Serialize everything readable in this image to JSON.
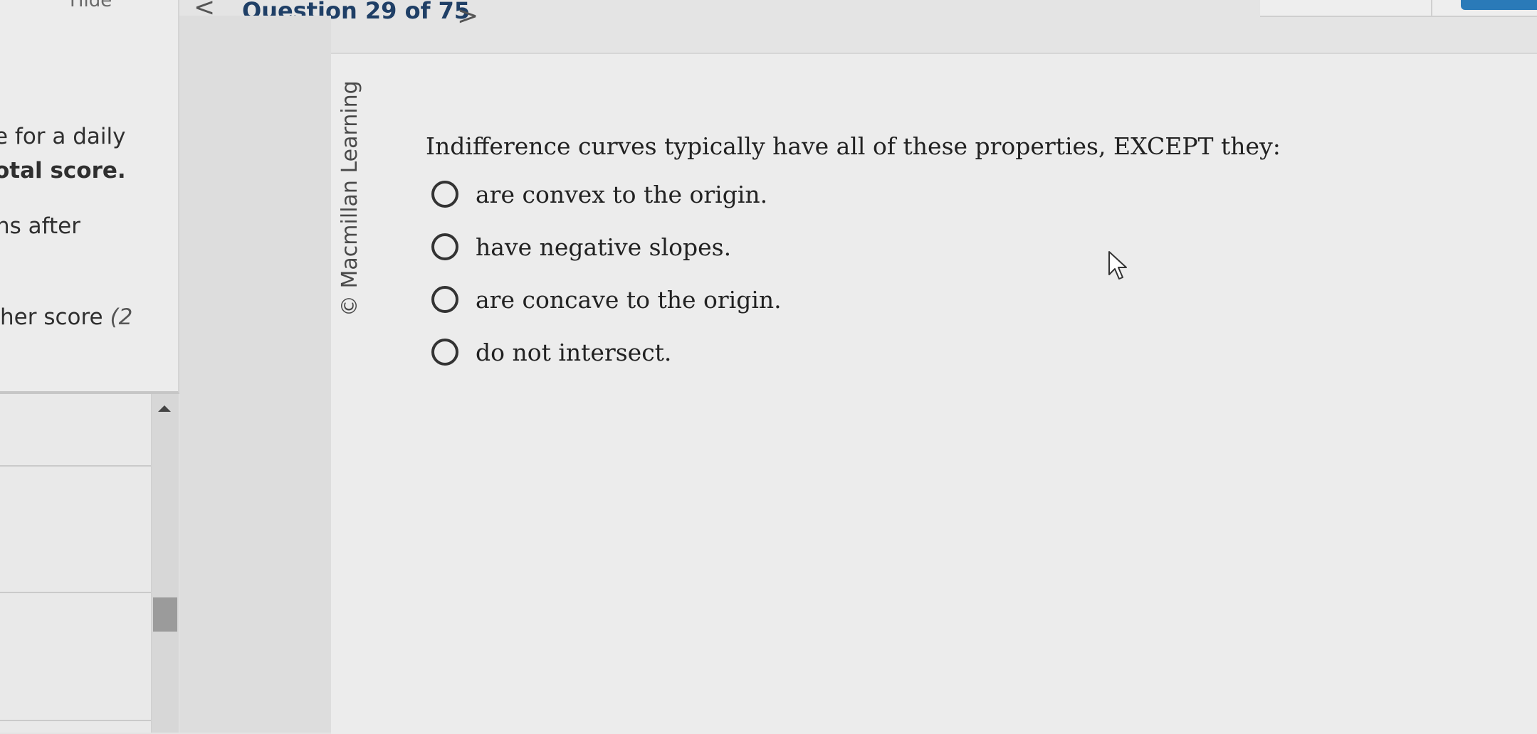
{
  "sidebar": {
    "hide_label": "Hide",
    "instructions": [
      "e for a daily",
      "otal score.",
      "ns after",
      "her score "
    ],
    "instructions_tail": "(2"
  },
  "nav": {
    "prev_symbol": "<",
    "next_symbol": ">",
    "question_counter": "Question 29 of 75"
  },
  "content": {
    "copyright": "© Macmillan Learning",
    "question": "Indifference curves typically have all of these properties, EXCEPT they:",
    "options": [
      "are convex to the origin.",
      "have negative slopes.",
      "are concave to the origin.",
      "do not intersect."
    ]
  },
  "colors": {
    "counter_text": "#1f3f66",
    "top_button": "#2a7ab8"
  },
  "icons": {
    "cursor": "arrow-cursor-icon",
    "scroll": "chevron-up-icon",
    "radio": "radio-unchecked-icon"
  }
}
